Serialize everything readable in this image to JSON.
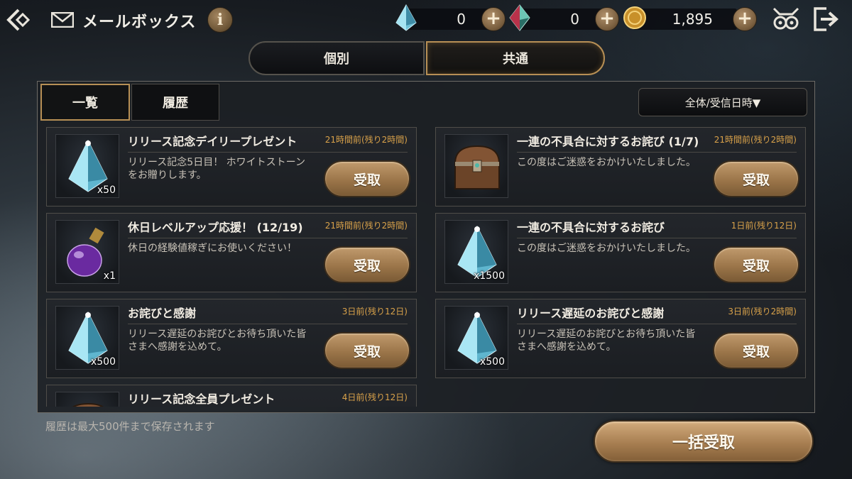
{
  "header": {
    "title": "メールボックス",
    "info_label": "i",
    "currencies": [
      {
        "name": "white-stone",
        "value": "0",
        "color": "#8fd4e8"
      },
      {
        "name": "red-stone",
        "value": "0",
        "color": "#c0394a"
      },
      {
        "name": "gold-coin",
        "value": "1,895",
        "color": "#d6a23a"
      }
    ],
    "plus_label": "+"
  },
  "tabs": [
    {
      "label": "個別",
      "active": false
    },
    {
      "label": "共通",
      "active": true
    }
  ],
  "subtabs": [
    {
      "label": "一覧",
      "active": true
    },
    {
      "label": "履歴",
      "active": false
    }
  ],
  "sort": {
    "label": "全体/受信日時▼"
  },
  "mails": [
    {
      "title": "リリース記念デイリープレゼント",
      "time": "21時間前(残り2時間)",
      "body": "リリース記念5日目！ ホワイトストーンをお贈りします。",
      "qty": "x50",
      "icon": "crystal-icon"
    },
    {
      "title": "一連の不具合に対するお詫び (1/7)",
      "time": "21時間前(残り2時間)",
      "body": "この度はご迷惑をおかけいたしました。",
      "qty": "",
      "icon": "treasure-chest-icon"
    },
    {
      "title": "休日レベルアップ応援！ (12/19)",
      "time": "21時間前(残り2時間)",
      "body": "休日の経験値稼ぎにお使いください！",
      "qty": "x1",
      "icon": "potion-icon"
    },
    {
      "title": "一連の不具合に対するお詫び",
      "time": "1日前(残り12日)",
      "body": "この度はご迷惑をおかけいたしました。",
      "qty": "x1500",
      "icon": "crystal-icon"
    },
    {
      "title": "お詫びと感謝",
      "time": "3日前(残り12日)",
      "body": "リリース遅延のお詫びとお待ち頂いた皆さまへ感謝を込めて。",
      "qty": "x500",
      "icon": "crystal-icon"
    },
    {
      "title": "リリース遅延のお詫びと感謝",
      "time": "3日前(残り2時間)",
      "body": "リリース遅延のお詫びとお待ち頂いた皆さまへ感謝を込めて。",
      "qty": "x500",
      "icon": "crystal-icon"
    },
    {
      "title": "リリース記念全員プレゼント",
      "time": "4日前(残り12日)",
      "body": "",
      "qty": "",
      "icon": "treasure-chest-icon"
    }
  ],
  "claim_label": "受取",
  "footer": {
    "note": "履歴は最大500件まで保存されます",
    "claim_all_label": "一括受取"
  },
  "colors": {
    "accent": "#b78f55",
    "time_text": "#d9a24a",
    "button": "#9b7549"
  }
}
